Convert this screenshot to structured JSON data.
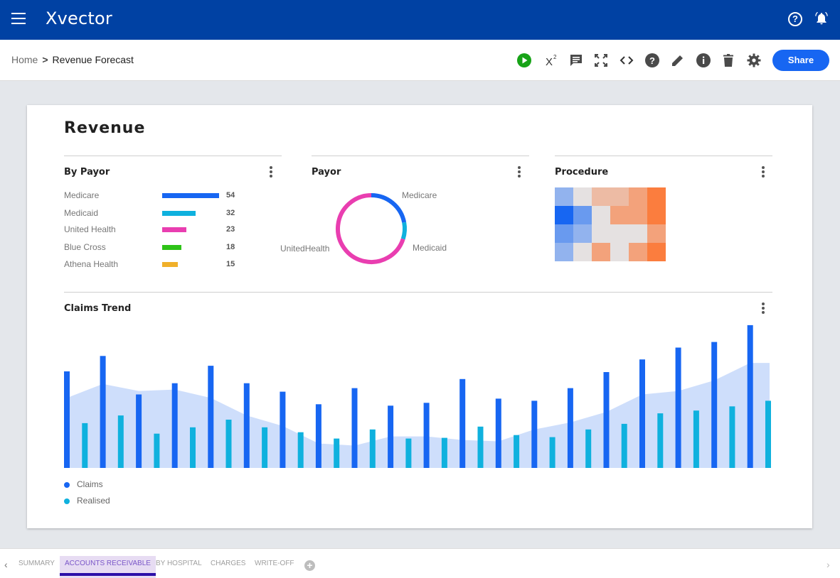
{
  "app": {
    "logo": "Xvector"
  },
  "breadcrumb": {
    "home": "Home",
    "separator": ">",
    "current": "Revenue Forecast"
  },
  "toolbar": {
    "share_label": "Share",
    "icons": [
      "play-icon",
      "superscript-icon",
      "comment-icon",
      "fullscreen-icon",
      "code-icon",
      "help-icon",
      "edit-icon",
      "info-icon",
      "delete-icon",
      "settings-icon"
    ]
  },
  "dashboard": {
    "title": "Revenue",
    "by_payor": {
      "title": "By Payor",
      "rows": [
        {
          "label": "Medicare",
          "value": "54",
          "color": "#1766f2"
        },
        {
          "label": "Medicaid",
          "value": "32",
          "color": "#0fb1de"
        },
        {
          "label": "United Health",
          "value": "23",
          "color": "#e93eb0"
        },
        {
          "label": "Blue Cross",
          "value": "18",
          "color": "#2ec318"
        },
        {
          "label": "Athena Health",
          "value": "15",
          "color": "#f0b02a"
        }
      ]
    },
    "payor": {
      "title": "Payor",
      "labels": {
        "medicare": "Medicare",
        "medicaid": "Medicaid",
        "united": "UnitedHealth"
      }
    },
    "procedure": {
      "title": "Procedure"
    },
    "claims_trend": {
      "title": "Claims Trend",
      "legend": {
        "claims": "Claims",
        "realised": "Realised"
      }
    }
  },
  "chart_data": [
    {
      "type": "bar",
      "title": "By Payor",
      "categories": [
        "Medicare",
        "Medicaid",
        "United Health",
        "Blue Cross",
        "Athena Health"
      ],
      "values": [
        54,
        32,
        23,
        18,
        15
      ]
    },
    {
      "type": "pie",
      "title": "Payor",
      "categories": [
        "Medicare",
        "Medicaid",
        "UnitedHealth"
      ],
      "values": [
        22,
        8,
        70
      ],
      "colors": [
        "#1766f2",
        "#0fb1de",
        "#e93eb0"
      ]
    },
    {
      "type": "heatmap",
      "title": "Procedure",
      "rows": 4,
      "cols": 6,
      "values": [
        [
          -0.4,
          0.05,
          0.35,
          0.35,
          0.55,
          0.85
        ],
        [
          -1.0,
          -0.6,
          0.05,
          0.55,
          0.55,
          0.85
        ],
        [
          -0.6,
          -0.4,
          0.05,
          0.05,
          0.05,
          0.55
        ],
        [
          -0.4,
          0.05,
          0.55,
          0.05,
          0.55,
          0.85
        ]
      ],
      "colors": {
        "low": "#1766f2",
        "mid": "#e4e7eb",
        "high": "#ff6a1f"
      }
    },
    {
      "type": "bar",
      "title": "Claims Trend",
      "series": [
        {
          "name": "Claims",
          "color": "#1766f2",
          "values": [
            138,
            160,
            105,
            121,
            146,
            121,
            109,
            91,
            114,
            89,
            93,
            127,
            99,
            96,
            114,
            137,
            155,
            172,
            180,
            204
          ]
        },
        {
          "name": "Realised",
          "color": "#0fb1de",
          "values": [
            64,
            75,
            49,
            58,
            69,
            58,
            51,
            42,
            55,
            42,
            43,
            59,
            47,
            44,
            55,
            63,
            78,
            82,
            88,
            96
          ]
        }
      ],
      "area": {
        "color": "#cbdcfb",
        "values": [
          100,
          120,
          110,
          112,
          100,
          75,
          60,
          35,
          32,
          45,
          45,
          40,
          38,
          55,
          65,
          80,
          105,
          110,
          125,
          150
        ]
      },
      "ylim": [
        0,
        210
      ]
    }
  ]
}
